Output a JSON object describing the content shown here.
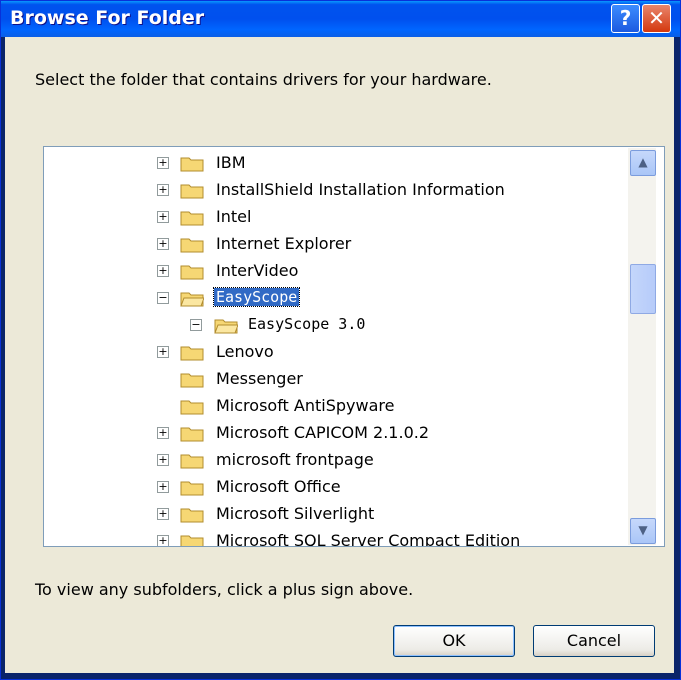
{
  "window": {
    "title": "Browse For Folder",
    "help_label": "?",
    "close_label": "✕"
  },
  "prompt": "Select the folder that contains drivers for your hardware.",
  "tree": {
    "items": [
      {
        "label": "IBM",
        "expander": "+"
      },
      {
        "label": "InstallShield Installation Information",
        "expander": "+"
      },
      {
        "label": "Intel",
        "expander": "+"
      },
      {
        "label": "Internet Explorer",
        "expander": "+"
      },
      {
        "label": "InterVideo",
        "expander": "+"
      },
      {
        "label": "EasyScope",
        "expander": "−",
        "selected": true
      },
      {
        "label": "EasyScope 3.0",
        "expander": "−"
      },
      {
        "label": "Lenovo",
        "expander": "+"
      },
      {
        "label": "Messenger",
        "expander": ""
      },
      {
        "label": "Microsoft AntiSpyware",
        "expander": ""
      },
      {
        "label": "Microsoft CAPICOM 2.1.0.2",
        "expander": "+"
      },
      {
        "label": "microsoft frontpage",
        "expander": "+"
      },
      {
        "label": "Microsoft Office",
        "expander": "+"
      },
      {
        "label": "Microsoft Silverlight",
        "expander": "+"
      },
      {
        "label": "Microsoft SQL Server Compact Edition",
        "expander": "+"
      }
    ]
  },
  "scrollbar": {
    "up_icon": "▲",
    "down_icon": "▼"
  },
  "hint": "To view any subfolders, click a plus sign above.",
  "buttons": {
    "ok": "OK",
    "cancel": "Cancel"
  },
  "colors": {
    "title_bar": "#0054e3",
    "selection": "#316ac5",
    "folder": "#f6d774"
  }
}
